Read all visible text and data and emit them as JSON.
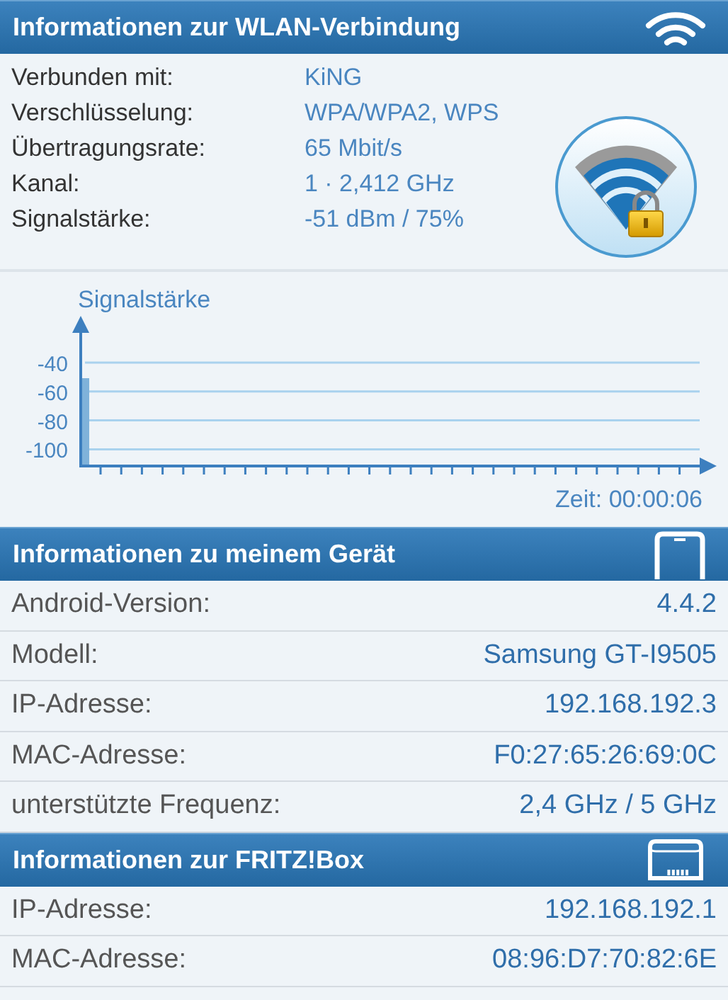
{
  "wlan": {
    "title": "Informationen zur WLAN-Verbindung",
    "rows": [
      {
        "label": "Verbunden mit:",
        "value": "KiNG"
      },
      {
        "label": "Verschlüsselung:",
        "value": "WPA/WPA2, WPS"
      },
      {
        "label": "Übertragungsrate:",
        "value": "65 Mbit/s"
      },
      {
        "label": "Kanal:",
        "value": "1 · 2,412 GHz"
      },
      {
        "label": "Signalstärke:",
        "value": "-51 dBm / 75%"
      }
    ],
    "signal_graph": {
      "title": "Signalstärke",
      "time_label": "Zeit: 00:00:06",
      "y_labels": [
        "-40",
        "-60",
        "-80",
        "-100"
      ]
    }
  },
  "device": {
    "title": "Informationen zu meinem Gerät",
    "rows": [
      {
        "label": "Android-Version:",
        "value": "4.4.2"
      },
      {
        "label": "Modell:",
        "value": "Samsung GT-I9505"
      },
      {
        "label": "IP-Adresse:",
        "value": "192.168.192.3"
      },
      {
        "label": "MAC-Adresse:",
        "value": "F0:27:65:26:69:0C"
      },
      {
        "label": "unterstützte Frequenz:",
        "value": "2,4 GHz / 5 GHz"
      }
    ]
  },
  "fritzbox": {
    "title": "Informationen zur FRITZ!Box",
    "rows": [
      {
        "label": "IP-Adresse:",
        "value": "192.168.192.1"
      },
      {
        "label": "MAC-Adresse:",
        "value": "08:96:D7:70:82:6E"
      }
    ]
  }
}
